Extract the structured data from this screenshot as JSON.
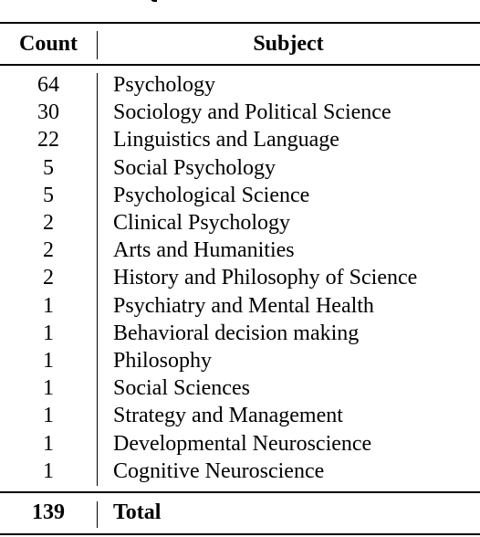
{
  "table": {
    "headers": {
      "count": "Count",
      "subject": "Subject"
    },
    "rows": [
      {
        "count": "64",
        "subject": "Psychology"
      },
      {
        "count": "30",
        "subject": "Sociology and Political Science"
      },
      {
        "count": "22",
        "subject": "Linguistics and Language"
      },
      {
        "count": "5",
        "subject": "Social Psychology"
      },
      {
        "count": "5",
        "subject": "Psychological Science"
      },
      {
        "count": "2",
        "subject": "Clinical Psychology"
      },
      {
        "count": "2",
        "subject": "Arts and Humanities"
      },
      {
        "count": "2",
        "subject": "History and Philosophy of Science"
      },
      {
        "count": "1",
        "subject": "Psychiatry and Mental Health"
      },
      {
        "count": "1",
        "subject": "Behavioral decision making"
      },
      {
        "count": "1",
        "subject": "Philosophy"
      },
      {
        "count": "1",
        "subject": "Social Sciences"
      },
      {
        "count": "1",
        "subject": "Strategy and Management"
      },
      {
        "count": "1",
        "subject": "Developmental Neuroscience"
      },
      {
        "count": "1",
        "subject": "Cognitive Neuroscience"
      }
    ],
    "total": {
      "count": "139",
      "label": "Total"
    }
  }
}
